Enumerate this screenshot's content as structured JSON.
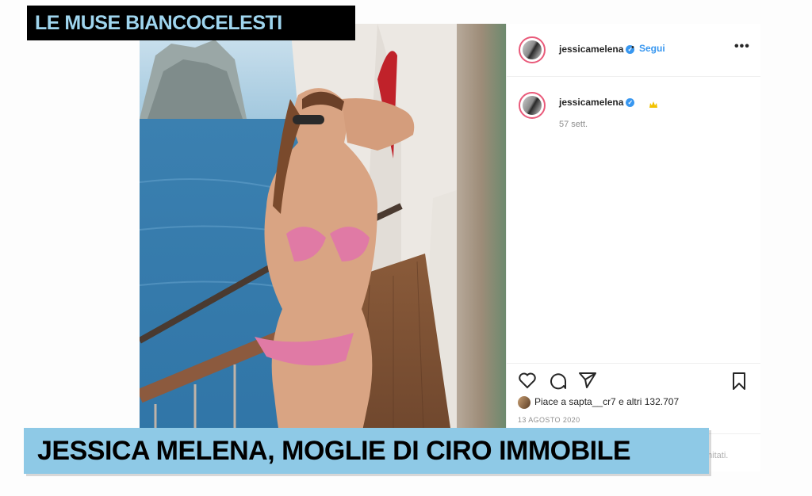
{
  "overlay": {
    "top_tag": "LE MUSE BIANCOCELESTI",
    "caption": "JESSICA MELENA, MOGLIE DI CIRO IMMOBILE"
  },
  "post": {
    "header": {
      "username": "jessicamelena",
      "separator": "•",
      "follow_label": "Segui",
      "more_label": "•••"
    },
    "caption": {
      "username": "jessicamelena",
      "time_ago": "57 sett."
    },
    "likes_text": "Piace a sapta__cr7 e altri 132.707",
    "date": "13 AGOSTO 2020",
    "comment_partial": "mitati."
  },
  "colors": {
    "tag_background": "#000000",
    "tag_text": "#9fd5ee",
    "caption_background": "#8ec9e6",
    "caption_text": "#000000",
    "link": "#3897f0"
  },
  "icons": [
    "heart-icon",
    "comment-icon",
    "share-icon",
    "bookmark-icon",
    "verified-icon",
    "crown-icon",
    "more-icon"
  ]
}
